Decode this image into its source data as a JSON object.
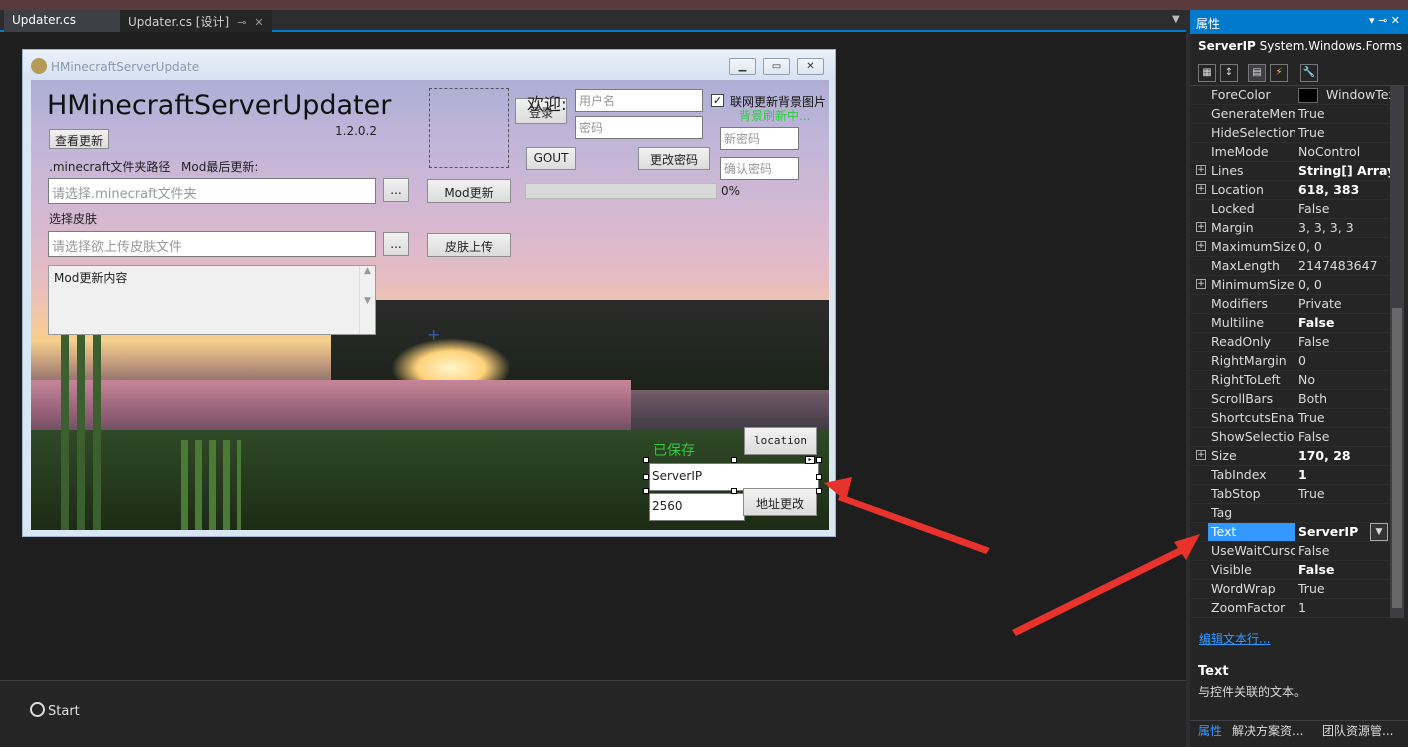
{
  "tabs": [
    {
      "label": "Updater.cs"
    },
    {
      "label": "Updater.cs [设计]"
    }
  ],
  "form": {
    "window_title": "HMinecraftServerUpdate",
    "app_title": "HMinecraftServerUpdater",
    "version": "1.2.0.2",
    "check_update_btn": "查看更新",
    "mc_path_label": ".minecraft文件夹路径",
    "mod_last_update_label": "Mod最后更新:",
    "mc_path_placeholder": "请选择.minecraft文件夹",
    "browse_btn": "...",
    "mod_update_btn": "Mod更新",
    "skin_label": "选择皮肤",
    "skin_placeholder": "请选择欲上传皮肤文件",
    "skin_upload_btn": "皮肤上传",
    "mod_content": "Mod更新内容",
    "welcome": "欢迎:",
    "login_btn": "登录",
    "username_placeholder": "用户名",
    "password_placeholder": "密码",
    "logout_btn": "GOUT",
    "change_pwd_btn": "更改密码",
    "new_pwd_placeholder": "新密码",
    "confirm_pwd_placeholder": "确认密码",
    "online_bg_checkbox": "联网更新背景图片",
    "online_bg_checked": true,
    "bg_status": "背景刷新中...",
    "progress_percent": "0%",
    "progress_value": 0,
    "location_btn": "location",
    "saved_label": "已保存",
    "server_ip_value": "ServerIP",
    "port_value": "2560",
    "addr_change_btn": "地址更改"
  },
  "bottom": {
    "start_label": "Start"
  },
  "properties": {
    "title": "属性",
    "object_name": "ServerIP",
    "object_type": "System.Windows.Forms",
    "rows": [
      {
        "name": "ForeColor",
        "value": "WindowText"
      },
      {
        "name": "GenerateMember",
        "value": "True"
      },
      {
        "name": "HideSelection",
        "value": "True"
      },
      {
        "name": "ImeMode",
        "value": "NoControl"
      },
      {
        "name": "Lines",
        "value": "String[] Array"
      },
      {
        "name": "Location",
        "value": "618, 383"
      },
      {
        "name": "Locked",
        "value": "False"
      },
      {
        "name": "Margin",
        "value": "3, 3, 3, 3"
      },
      {
        "name": "MaximumSize",
        "value": "0, 0"
      },
      {
        "name": "MaxLength",
        "value": "2147483647"
      },
      {
        "name": "MinimumSize",
        "value": "0, 0"
      },
      {
        "name": "Modifiers",
        "value": "Private"
      },
      {
        "name": "Multiline",
        "value": "False"
      },
      {
        "name": "ReadOnly",
        "value": "False"
      },
      {
        "name": "RightMargin",
        "value": "0"
      },
      {
        "name": "RightToLeft",
        "value": "No"
      },
      {
        "name": "ScrollBars",
        "value": "Both"
      },
      {
        "name": "ShortcutsEnabled",
        "value": "True"
      },
      {
        "name": "ShowSelectionMargin",
        "value": "False"
      },
      {
        "name": "Size",
        "value": "170, 28"
      },
      {
        "name": "TabIndex",
        "value": "1"
      },
      {
        "name": "TabStop",
        "value": "True"
      },
      {
        "name": "Tag",
        "value": ""
      },
      {
        "name": "Text",
        "value": "ServerIP"
      },
      {
        "name": "UseWaitCursor",
        "value": "False"
      },
      {
        "name": "Visible",
        "value": "False"
      },
      {
        "name": "WordWrap",
        "value": "True"
      },
      {
        "name": "ZoomFactor",
        "value": "1"
      }
    ],
    "edit_lines_link": "编辑文本行...",
    "desc_title": "Text",
    "desc_text": "与控件关联的文本。",
    "bottom_tabs": [
      {
        "label": "属性"
      },
      {
        "label": "解决方案资..."
      },
      {
        "label": "团队资源管..."
      }
    ]
  },
  "colors": {
    "accent": "#007acc",
    "selection": "#3399ff",
    "status_green": "#2ecc40",
    "annotation_arrow": "#e8322c"
  }
}
